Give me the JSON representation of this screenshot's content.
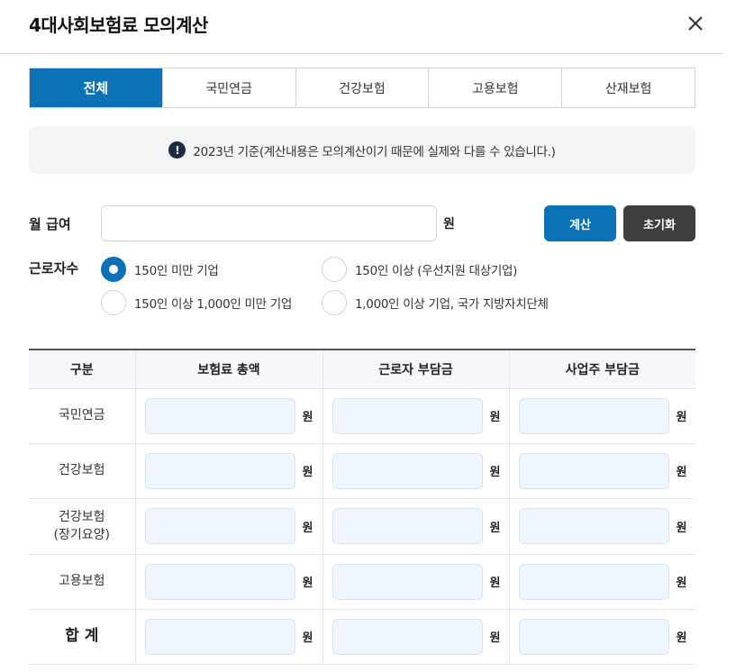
{
  "window": {
    "title": "4대사회보험료 모의계산"
  },
  "tabs": [
    {
      "label": "전체",
      "active": true
    },
    {
      "label": "국민연금",
      "active": false
    },
    {
      "label": "건강보험",
      "active": false
    },
    {
      "label": "고용보험",
      "active": false
    },
    {
      "label": "산재보험",
      "active": false
    }
  ],
  "notice": {
    "icon": "exclamation-icon",
    "icon_glyph": "!",
    "text": "2023년 기준(계산내용은 모의계산이기 때문에 실제와 다를 수 있습니다.)"
  },
  "salary": {
    "label": "월 급여",
    "value": "",
    "unit": "원"
  },
  "buttons": {
    "calculate": "계산",
    "reset": "초기화"
  },
  "workers": {
    "label": "근로자수",
    "options": [
      {
        "label": "150인 미만 기업",
        "checked": true
      },
      {
        "label": "150인 이상 (우선지원 대상기업)",
        "checked": false
      },
      {
        "label": "150인 이상 1,000인 미만 기업",
        "checked": false
      },
      {
        "label": "1,000인 이상 기업, 국가 지방자치단체",
        "checked": false
      }
    ]
  },
  "table": {
    "headers": [
      "구분",
      "보험료 총액",
      "근로자 부담금",
      "사업주 부담금"
    ],
    "unit": "원",
    "rows": [
      {
        "label": "국민연금",
        "label2": ""
      },
      {
        "label": "건강보험",
        "label2": ""
      },
      {
        "label": "건강보험",
        "label2": "(장기요양)"
      },
      {
        "label": "고용보험",
        "label2": ""
      },
      {
        "label": "합 계",
        "label2": ""
      }
    ]
  },
  "colors": {
    "accent": "#0b72b8",
    "dark_button": "#3e3e3e",
    "input_fill": "#eef5ff",
    "notice_bg": "#f3f4f5"
  }
}
